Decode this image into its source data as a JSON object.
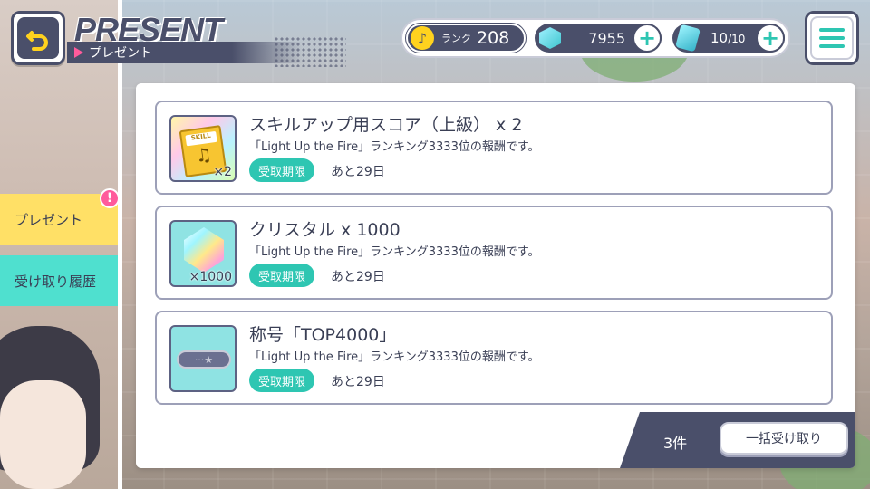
{
  "header": {
    "title_en": "PRESENT",
    "subtitle": "プレゼント"
  },
  "status": {
    "rank_label": "ランク",
    "rank_value": "208",
    "crystal_value": "7955",
    "stamina_value": "10",
    "stamina_max": "/10"
  },
  "tabs": [
    {
      "label": "プレゼント",
      "active": true,
      "alert": "!"
    },
    {
      "label": "受け取り履歴",
      "active": false
    }
  ],
  "items": [
    {
      "title": "スキルアップ用スコア（上級） x 2",
      "description": "「Light Up the Fire」ランキング3333位の報酬です。",
      "deadline_label": "受取期限",
      "deadline_value": "あと29日",
      "thumb_qty": "×2",
      "thumb_label": "SKILL",
      "icon": "skill-score-icon"
    },
    {
      "title": "クリスタル x 1000",
      "description": "「Light Up the Fire」ランキング3333位の報酬です。",
      "deadline_label": "受取期限",
      "deadline_value": "あと29日",
      "thumb_qty": "×1000",
      "icon": "crystal-icon"
    },
    {
      "title": "称号「TOP4000」",
      "description": "「Light Up the Fire」ランキング3333位の報酬です。",
      "deadline_label": "受取期限",
      "deadline_value": "あと29日",
      "thumb_qty": "",
      "icon": "title-plate-icon"
    }
  ],
  "footer": {
    "count": "3件",
    "bulk_receive_label": "一括受け取り"
  },
  "colors": {
    "navy": "#4a4f6a",
    "teal": "#2ec6b2",
    "yellow_tab": "#ffe066",
    "cyan_tab": "#4fe0cf",
    "pink": "#ff5b9b"
  }
}
